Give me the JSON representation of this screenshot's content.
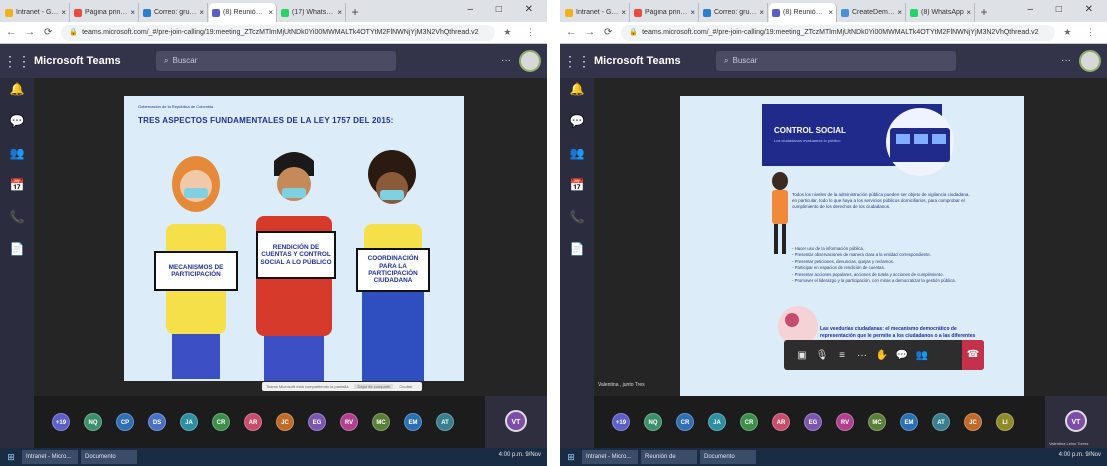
{
  "left": {
    "tabs": [
      {
        "label": "Intranet - Gobernación de S",
        "color": "#f2b01e",
        "active": false
      },
      {
        "label": "Página principal de Microsof",
        "color": "#e74c3c",
        "active": false
      },
      {
        "label": "Correo: grupojuventudes - O",
        "color": "#2b7cd3",
        "active": false
      },
      {
        "label": "(8) Reunión | Microsoft",
        "color": "#5b5fc7",
        "active": true
      },
      {
        "label": "(17) WhatsApp",
        "color": "#25d366",
        "active": false
      }
    ],
    "url": "teams.microsoft.com/_#/pre-join-calling/19:meeting_ZTczMTlmMjUtNDk0Yi00MWMALTk4OTYtM2FlNWNjYjM3N2VhQthread.v2",
    "app_title": "Microsoft Teams",
    "search_placeholder": "Buscar",
    "slide": {
      "header": "Gobernación de la República de Colombia",
      "title": "TRES ASPECTOS FUNDAMENTALES DE LA LEY 1757 DEL 2015:",
      "signs": [
        "MECANISMOS DE PARTICIPACIÓN",
        "RENDICIÓN DE CUENTAS Y CONTROL SOCIAL A LO PÚBLICO",
        "COORDINACIÓN PARA LA PARTICIPACIÓN CIUDADANA"
      ]
    },
    "share_notice": "Teams Microsoft está compartiendo la pantalla",
    "share_stop": "Dejar de compartir",
    "share_hide": "Ocultar",
    "participants": [
      {
        "initials": "+19",
        "color": "#5b5fc7"
      },
      {
        "initials": "NQ",
        "color": "#3c8f6a"
      },
      {
        "initials": "CP",
        "color": "#2f6fb4"
      },
      {
        "initials": "DS",
        "color": "#4a6fc4"
      },
      {
        "initials": "JA",
        "color": "#2d8fa0"
      },
      {
        "initials": "CR",
        "color": "#3b8f4a"
      },
      {
        "initials": "AR",
        "color": "#c64e6c"
      },
      {
        "initials": "JC",
        "color": "#c06a2a"
      },
      {
        "initials": "EG",
        "color": "#7a56b0"
      },
      {
        "initials": "RV",
        "color": "#b0408e"
      },
      {
        "initials": "MC",
        "color": "#5a7f3a"
      },
      {
        "initials": "EM",
        "color": "#2a6fb0"
      },
      {
        "initials": "AT",
        "color": "#3a7f8f"
      }
    ],
    "me_initials": "VT",
    "taskbar": [
      "Intranet - Micro...",
      "Documento"
    ],
    "tray": "4:00 p.m. 9/Nov"
  },
  "right": {
    "tabs": [
      {
        "label": "Intranet - Gobernació",
        "color": "#f2b01e",
        "active": false
      },
      {
        "label": "Página principal de",
        "color": "#e74c3c",
        "active": false
      },
      {
        "label": "Correo: grupojuvent",
        "color": "#2b7cd3",
        "active": false
      },
      {
        "label": "(8) Reunión de",
        "color": "#5b5fc7",
        "active": true
      },
      {
        "label": "CreateDemo Sobre",
        "color": "#4a90d9",
        "active": false
      },
      {
        "label": "(8) WhatsApp",
        "color": "#25d366",
        "active": false
      }
    ],
    "url": "teams.microsoft.com/_#/pre-join-calling/19:meeting_ZTczMTlmMjUtNDk0Yi00MWMALTk4OTYtM2FlNWNjYjM3N2VhQthread.v2",
    "app_title": "Microsoft Teams",
    "search_placeholder": "Buscar",
    "slide": {
      "banner_title": "CONTROL SOCIAL",
      "banner_sub": "Los ciudadanos evaluamos lo público",
      "paragraph": "Todos los niveles de la administración pública pueden ser objeto de vigilancia ciudadana, en particular, todo lo que haya a los servicios públicos domiciliarios, para comprobar el cumplimiento de los derechos de los ciudadanos.",
      "list": [
        "- Hacer uso de la información pública.",
        "- Presentar observaciones de manera clara a la entidad correspondiente.",
        "- Presentar peticiones, denuncias, quejas y reclamos.",
        "- Participar en espacios de rendición de cuentas.",
        "- Presentar acciones populares, acciones de tutela y acciones de cumplimiento.",
        "- Promover el liderazgo y la participación, con miras a democratizar la gestión pública."
      ],
      "bottom_text": "Las veedurías ciudadanas: el mecanismo democrático de representación que le permite a los ciudadanos o a las diferentes organizaciones"
    },
    "presenter": "Valentina , junto Tres",
    "participants": [
      {
        "initials": "+19",
        "color": "#5b5fc7"
      },
      {
        "initials": "NQ",
        "color": "#3c8f6a"
      },
      {
        "initials": "CR",
        "color": "#2f6fb4"
      },
      {
        "initials": "JA",
        "color": "#2d8fa0"
      },
      {
        "initials": "CR",
        "color": "#3b8f4a"
      },
      {
        "initials": "AR",
        "color": "#c64e6c"
      },
      {
        "initials": "EG",
        "color": "#7a56b0"
      },
      {
        "initials": "RV",
        "color": "#b0408e"
      },
      {
        "initials": "MC",
        "color": "#5a7f3a"
      },
      {
        "initials": "EM",
        "color": "#2a6fb0"
      },
      {
        "initials": "AT",
        "color": "#3a7f8f"
      },
      {
        "initials": "JC",
        "color": "#c06a2a"
      },
      {
        "initials": "LI",
        "color": "#8f8a2a"
      }
    ],
    "me_initials": "VT",
    "me_name": "Valentina Leino Torres",
    "taskbar": [
      "Intranet - Micro...",
      "Reunión de",
      "Documento"
    ],
    "tray": "4:00 p.m. 9/Nov"
  }
}
